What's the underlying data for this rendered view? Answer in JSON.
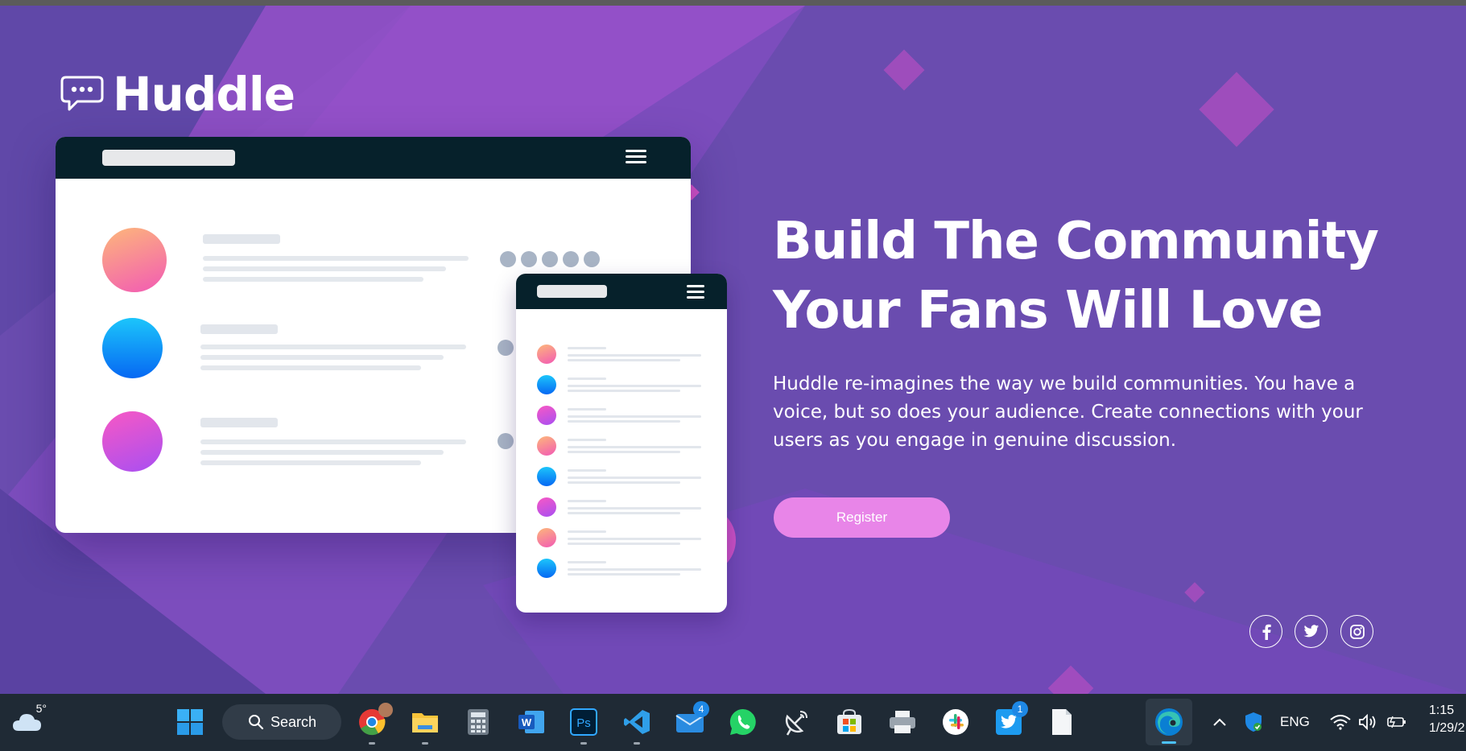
{
  "brand": {
    "name": "Huddle"
  },
  "hero": {
    "headline_line1": "Build The Community",
    "headline_line2": "Your Fans Will Love",
    "description": "Huddle re-imagines the way we build communities. You have a voice, but so does your audience. Create connections with your users as you engage in genuine discussion.",
    "register_label": "Register"
  },
  "social": [
    {
      "name": "facebook-icon",
      "glyph": "f"
    },
    {
      "name": "twitter-icon",
      "glyph": "twitter"
    },
    {
      "name": "instagram-icon",
      "glyph": "instagram"
    }
  ],
  "colors": {
    "background": "#6a4caf",
    "browser_bar": "#06212b",
    "button": "#e885e8",
    "taskbar": "#1f2a35"
  },
  "taskbar": {
    "weather_temp": "5°",
    "search_label": "Search",
    "mail_badge": "4",
    "twitter_badge": "1",
    "language": "ENG",
    "time": "1:15",
    "date": "1/29/2"
  }
}
